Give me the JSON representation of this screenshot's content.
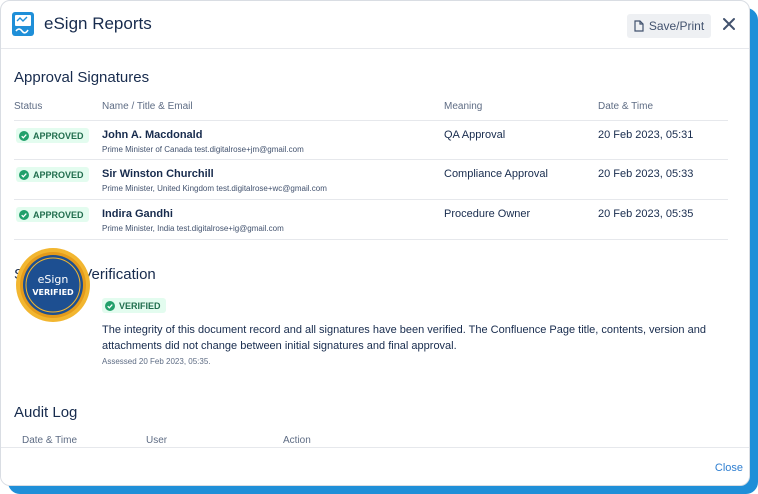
{
  "header": {
    "title": "eSign Reports",
    "save_label": "Save/Print"
  },
  "approval": {
    "title": "Approval Signatures",
    "columns": {
      "status": "Status",
      "name": "Name / Title & Email",
      "meaning": "Meaning",
      "datetime": "Date & Time"
    },
    "rows": [
      {
        "status": "APPROVED",
        "name": "John A. Macdonald",
        "sub": "Prime Minister of Canada test.digitalrose+jm@gmail.com",
        "meaning": "QA Approval",
        "datetime": "20 Feb 2023, 05:31"
      },
      {
        "status": "APPROVED",
        "name": "Sir Winston Churchill",
        "sub": "Prime Minister, United Kingdom test.digitalrose+wc@gmail.com",
        "meaning": "Compliance Approval",
        "datetime": "20 Feb 2023, 05:33"
      },
      {
        "status": "APPROVED",
        "name": "Indira Gandhi",
        "sub": "Prime Minister, India test.digitalrose+ig@gmail.com",
        "meaning": "Procedure Owner",
        "datetime": "20 Feb 2023, 05:35"
      }
    ]
  },
  "verification": {
    "title": "Signature Verification",
    "badge": "VERIFIED",
    "seal_top": "eSign",
    "seal_bottom": "VERIFIED",
    "text": "The integrity of this document record and all signatures have been verified. The Confluence Page title, contents, version and attachments did not change between initial signatures and final approval.",
    "assessed": "Assessed 20 Feb 2023, 05:35."
  },
  "audit": {
    "title": "Audit Log",
    "columns": {
      "datetime": "Date & Time",
      "user": "User",
      "action": "Action"
    }
  },
  "footer": {
    "close_label": "Close"
  },
  "colors": {
    "accent": "#1f8fd8",
    "approved_bg": "#e3fcef",
    "approved_fg": "#216e4e",
    "link": "#2f7fd1"
  }
}
